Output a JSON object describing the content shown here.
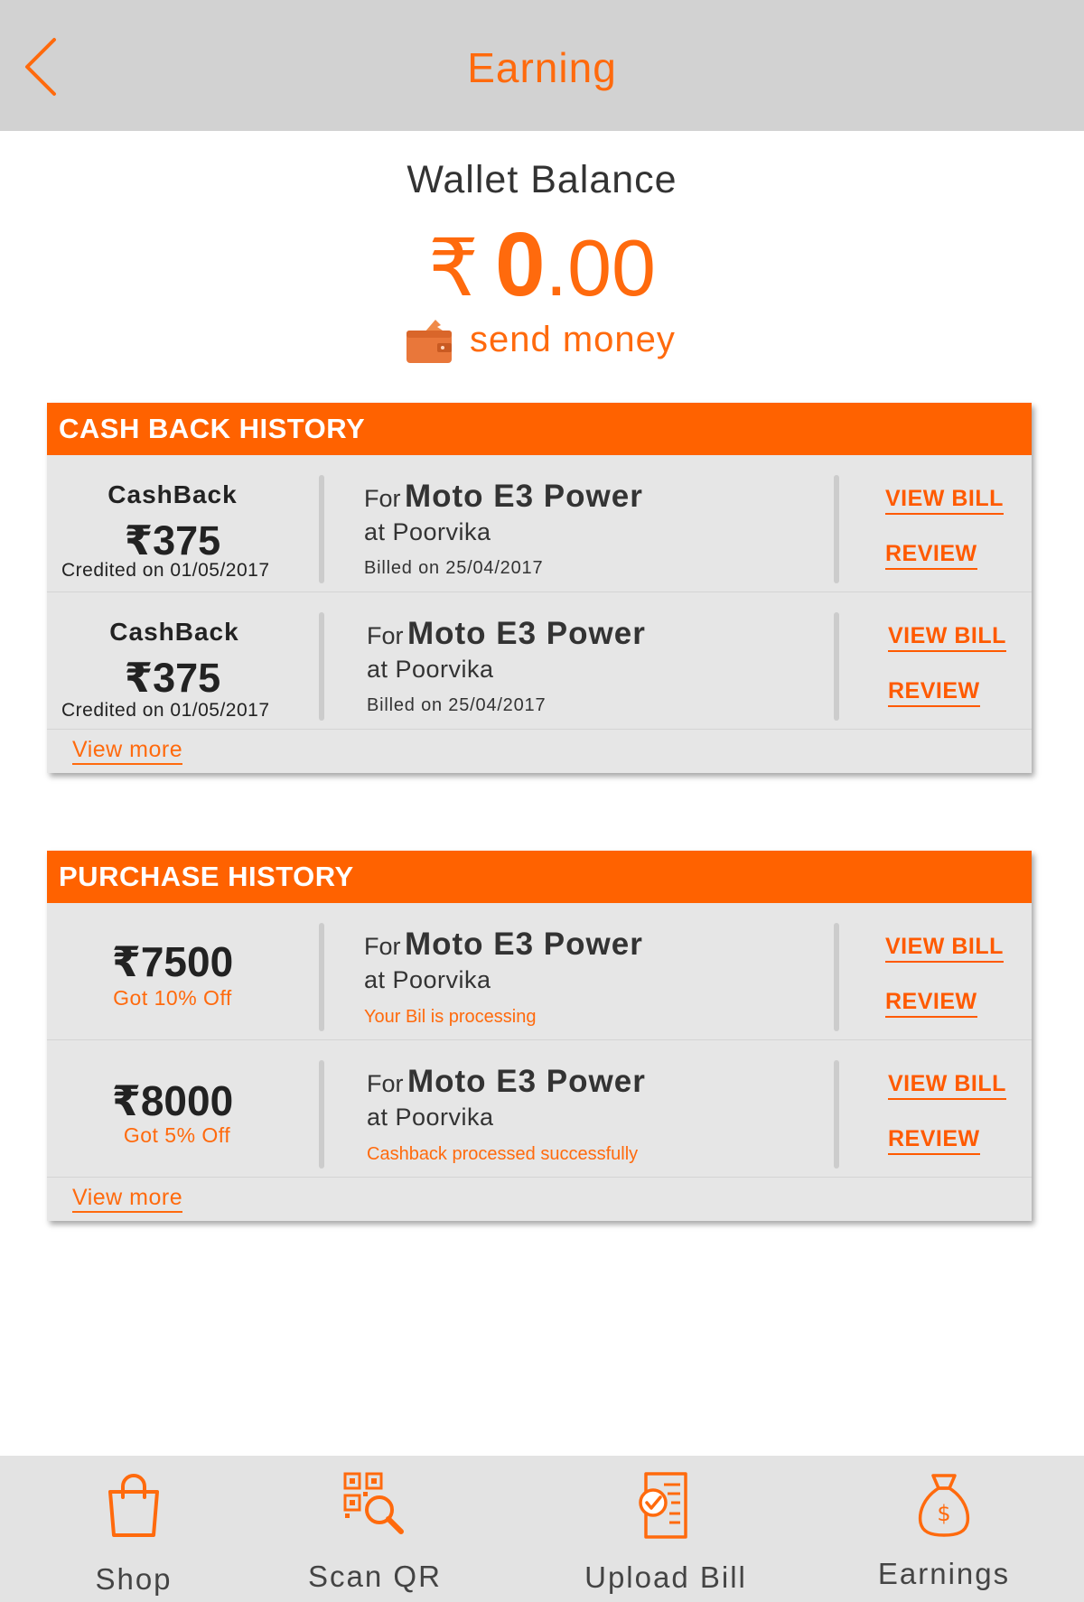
{
  "header": {
    "title": "Earning"
  },
  "wallet": {
    "title": "Wallet Balance",
    "currency": "₹",
    "amount_int": "0",
    "amount_dec": ".00",
    "send_money_label": "send money"
  },
  "cashback_history": {
    "title": "CASH BACK HISTORY",
    "rows": [
      {
        "label": "CashBack",
        "amount": "₹375",
        "credited": "Credited on 01/05/2017",
        "for_text": "For",
        "product": "Moto E3 Power",
        "store": "at Poorvika",
        "billed": "Billed on 25/04/2017",
        "view_bill": "VIEW BILL",
        "review": "REVIEW"
      },
      {
        "label": "CashBack",
        "amount": "₹375",
        "credited": "Credited on 01/05/2017",
        "for_text": "For",
        "product": "Moto E3 Power",
        "store": "at Poorvika",
        "billed": "Billed on 25/04/2017",
        "view_bill": "VIEW BILL",
        "review": "REVIEW"
      }
    ],
    "view_more": "View more"
  },
  "purchase_history": {
    "title": "PURCHASE HISTORY",
    "rows": [
      {
        "amount": "₹7500",
        "discount": "Got 10% Off",
        "for_text": "For",
        "product": "Moto E3 Power",
        "store": "at Poorvika",
        "status": "Your Bil is processing",
        "view_bill": "VIEW BILL",
        "review": "REVIEW"
      },
      {
        "amount": "₹8000",
        "discount": "Got 5% Off",
        "for_text": "For",
        "product": "Moto E3 Power",
        "store": "at Poorvika",
        "status": "Cashback processed successfully",
        "view_bill": "VIEW BILL",
        "review": "REVIEW"
      }
    ],
    "view_more": "View more"
  },
  "bottom_nav": [
    {
      "label": "Shop",
      "icon": "shopping-bag-icon"
    },
    {
      "label": "Scan QR",
      "icon": "qr-scan-icon"
    },
    {
      "label": "Upload Bill",
      "icon": "upload-bill-icon"
    },
    {
      "label": "Earnings",
      "icon": "money-bag-icon"
    }
  ],
  "colors": {
    "accent": "#ff6a0d",
    "header_bg": "#d2d2d2",
    "card_bg": "#e6e6e6",
    "nav_bg": "#e3e3e3"
  }
}
